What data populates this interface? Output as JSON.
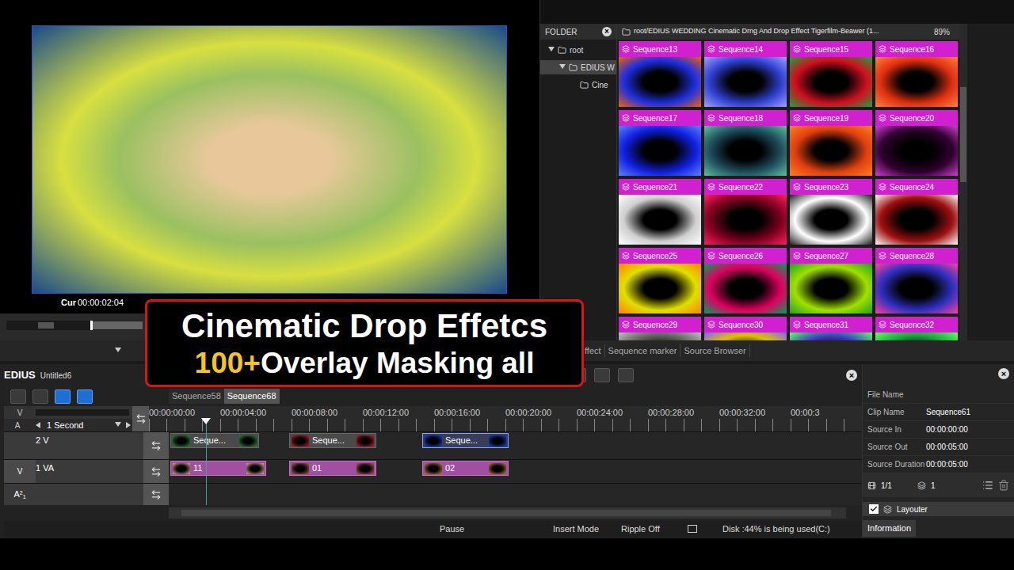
{
  "preview": {
    "timecode_label": "Cur",
    "timecode": "00:00:02:04"
  },
  "folder_panel": {
    "title": "FOLDER",
    "close": "×",
    "tree": [
      {
        "label": "root",
        "expanded": true,
        "selected": false
      },
      {
        "label": "EDIUS W",
        "expanded": true,
        "selected": true
      },
      {
        "label": "Cine",
        "expanded": false,
        "selected": false
      }
    ]
  },
  "bin": {
    "path": "root/EDIUS WEDDING Cinematic Drng And Drop Effect Tigerfilm-Beawer (1...",
    "zoom": "89%",
    "items": [
      {
        "name": "Sequence13",
        "color": "#2030e0",
        "accent": "#f06010"
      },
      {
        "name": "Sequence14",
        "color": "#3040d0",
        "accent": "#a0a0ff"
      },
      {
        "name": "Sequence15",
        "color": "#d01020",
        "accent": "#20a040"
      },
      {
        "name": "Sequence16",
        "color": "#e03010",
        "accent": "#ff8040"
      },
      {
        "name": "Sequence17",
        "color": "#1020e0",
        "accent": "#6080ff"
      },
      {
        "name": "Sequence18",
        "color": "#205060",
        "accent": "#60c0a0"
      },
      {
        "name": "Sequence19",
        "color": "#e04010",
        "accent": "#ff8020"
      },
      {
        "name": "Sequence20",
        "color": "#300030",
        "accent": "#d040d0"
      },
      {
        "name": "Sequence21",
        "color": "#d0d0d0",
        "accent": "#ffffff"
      },
      {
        "name": "Sequence22",
        "color": "#800020",
        "accent": "#ff2060"
      },
      {
        "name": "Sequence23",
        "color": "#ffffff",
        "accent": "#202020"
      },
      {
        "name": "Sequence24",
        "color": "#a01010",
        "accent": "#ffffff"
      },
      {
        "name": "Sequence25",
        "color": "#e0e000",
        "accent": "#ff8000"
      },
      {
        "name": "Sequence26",
        "color": "#e00060",
        "accent": "#00a060"
      },
      {
        "name": "Sequence27",
        "color": "#a0e000",
        "accent": "#20a020"
      },
      {
        "name": "Sequence28",
        "color": "#3030c0",
        "accent": "#ff40a0"
      },
      {
        "name": "Sequence29",
        "color": "#606060",
        "accent": "#c0c0c0"
      },
      {
        "name": "Sequence30",
        "color": "#e0c000",
        "accent": "#8060ff"
      },
      {
        "name": "Sequence31",
        "color": "#4040c0",
        "accent": "#60ff60"
      },
      {
        "name": "Sequence32",
        "color": "#20a040",
        "accent": "#60ff60"
      }
    ]
  },
  "panel_tabs": [
    {
      "label": "ffect",
      "selected": false
    },
    {
      "label": "Sequence marker",
      "selected": false
    },
    {
      "label": "Source Browser",
      "selected": false
    }
  ],
  "title_overlay": {
    "heading": "Cinematic Drop Effetcs",
    "highlight": "100+",
    "subheading": "Overlay Masking all"
  },
  "timeline": {
    "app": "EDIUS",
    "project": "Untitled6",
    "close": "×",
    "sequences": [
      {
        "label": "Sequence58",
        "selected": false
      },
      {
        "label": "Sequence68",
        "selected": true
      }
    ],
    "video_label": "V",
    "audio_label": "A",
    "scale": "1 Second",
    "ruler": [
      "00:00:00:00",
      "00:00:04:00",
      "00:00:08:00",
      "00:00:12:00",
      "00:00:16:00",
      "00:00:20:00",
      "00:00:24:00",
      "00:00:28:00",
      "00:00:32:00",
      "00:00:3"
    ],
    "tracks": [
      {
        "name": "2 V",
        "kind": "video",
        "sub": "",
        "sup": "",
        "clips": [
          {
            "label": "Seque...",
            "color": "#2a8a3a",
            "selected": false
          },
          {
            "label": "Seque...",
            "color": "#c02030",
            "selected": false
          },
          {
            "label": "Seque...",
            "color": "#2040d0",
            "selected": true
          }
        ]
      },
      {
        "name": "1 VA",
        "kind": "videoaudio",
        "sub": "",
        "sup": "",
        "clips": [
          {
            "label": "11",
            "color": "#e0b090",
            "selected": false
          },
          {
            "label": "01",
            "color": "#b06050",
            "selected": false
          },
          {
            "label": "02",
            "color": "#c08040",
            "selected": false
          }
        ]
      },
      {
        "name": "A",
        "kind": "audio",
        "sub": "1",
        "sup": "2",
        "clips": []
      }
    ]
  },
  "status_bar": {
    "items": [
      "Pause",
      "Insert Mode",
      "Ripple Off",
      "Disk :44% is being used(C:)"
    ]
  },
  "info_panel": {
    "close": "×",
    "fields": [
      {
        "label": "File Name",
        "value": ""
      },
      {
        "label": "Clip Name",
        "value": "Sequence61"
      },
      {
        "label": "Source In",
        "value": "00:00:00:00"
      },
      {
        "label": "Source Out",
        "value": "00:00:05:00"
      },
      {
        "label": "Source Duration",
        "value": "00:00:05:00"
      }
    ],
    "page": "1/1",
    "count": "1",
    "effects": [
      {
        "label": "Layouter",
        "checked": true
      }
    ],
    "tab": "Information"
  }
}
